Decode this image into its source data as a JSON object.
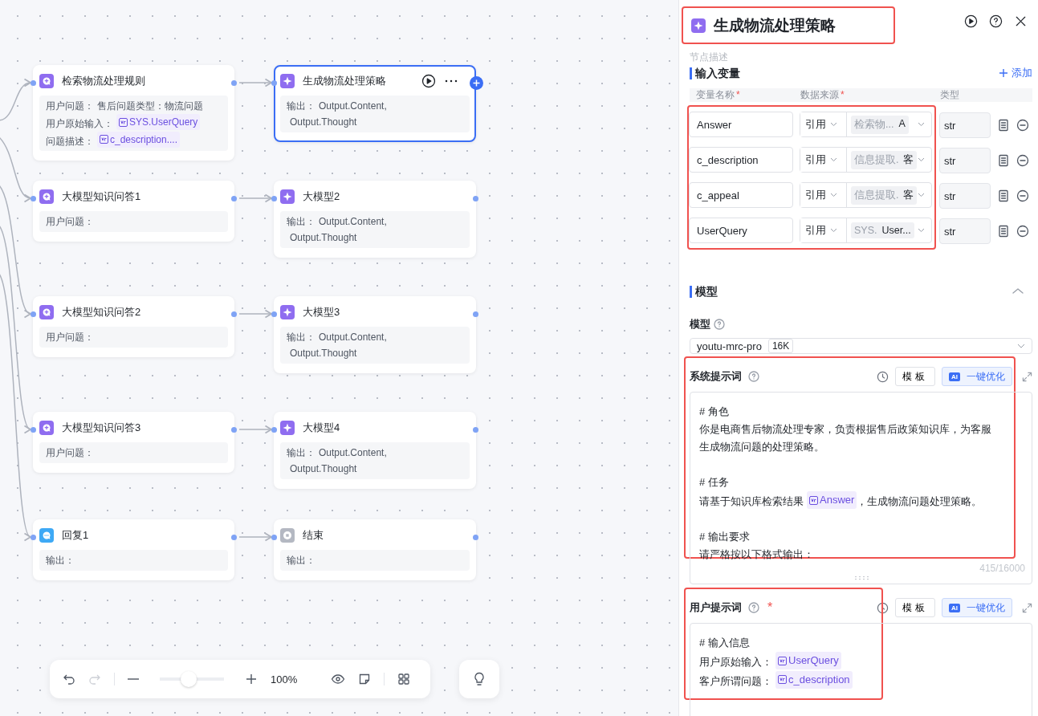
{
  "canvas": {
    "nodes": [
      {
        "kind": "knowledge",
        "title": "检索物流处理规则",
        "selected": false,
        "lines": [
          {
            "label": "用户问题：",
            "text": "售后问题类型：物流问题"
          },
          {
            "label": "用户原始输入：",
            "var": "SYS.UserQuery"
          },
          {
            "label": "问题描述：",
            "var": "c_description...."
          }
        ]
      },
      {
        "kind": "llm",
        "title": "生成物流处理策略",
        "selected": true,
        "lines": [
          {
            "label": "输出：",
            "text": "Output.Content,"
          },
          {
            "text": "Output.Thought"
          }
        ]
      },
      {
        "kind": "knowledge",
        "title": "大模型知识问答1",
        "selected": false,
        "lines": [
          {
            "label": "用户问题："
          }
        ]
      },
      {
        "kind": "llm",
        "title": "大模型2",
        "selected": false,
        "lines": [
          {
            "label": "输出：",
            "text": "Output.Content,"
          },
          {
            "text": "Output.Thought"
          }
        ]
      },
      {
        "kind": "knowledge",
        "title": "大模型知识问答2",
        "selected": false,
        "lines": [
          {
            "label": "用户问题："
          }
        ]
      },
      {
        "kind": "llm",
        "title": "大模型3",
        "selected": false,
        "lines": [
          {
            "label": "输出：",
            "text": "Output.Content,"
          },
          {
            "text": "Output.Thought"
          }
        ]
      },
      {
        "kind": "knowledge",
        "title": "大模型知识问答3",
        "selected": false,
        "lines": [
          {
            "label": "用户问题："
          }
        ]
      },
      {
        "kind": "llm",
        "title": "大模型4",
        "selected": false,
        "lines": [
          {
            "label": "输出：",
            "text": "Output.Content,"
          },
          {
            "text": "Output.Thought"
          }
        ]
      },
      {
        "kind": "reply",
        "title": "回复1",
        "selected": false,
        "lines": [
          {
            "label": "输出："
          }
        ]
      },
      {
        "kind": "end",
        "title": "结束",
        "selected": false,
        "lines": [
          {
            "label": "输出："
          }
        ]
      }
    ],
    "toolbar": {
      "zoom": "100%",
      "level": 0.45,
      "redo_disabled": true
    }
  },
  "panel": {
    "title": "生成物流处理策略",
    "description_placeholder": "节点描述",
    "inputs": {
      "title": "输入变量",
      "add": "添加",
      "columns": [
        {
          "label": "变量名称",
          "required_mark": "*"
        },
        {
          "label": "数据来源",
          "required_mark": "*"
        },
        {
          "label": "类型"
        }
      ],
      "rows": [
        {
          "name": "Answer",
          "mode": "引用",
          "source_node": "检索物...",
          "source_field": "A",
          "type": "str"
        },
        {
          "name": "c_description",
          "mode": "引用",
          "source_node": "信息提取.",
          "source_field": "客",
          "type": "str"
        },
        {
          "name": "c_appeal",
          "mode": "引用",
          "source_node": "信息提取.",
          "source_field": "客",
          "type": "str"
        },
        {
          "name": "UserQuery",
          "mode": "引用",
          "source_node": "SYS.",
          "source_field": "User...",
          "type": "str"
        }
      ]
    },
    "model_section": {
      "title": "模型",
      "expanded": true,
      "label": "模型",
      "model": "youtu-mrc-pro",
      "context": "16K"
    },
    "prompts": [
      {
        "label": "系统提示词",
        "template": "模板",
        "badge": "AI",
        "optimize": "一键优化",
        "counter": "415/16000",
        "lines": [
          {
            "kind": "gap"
          },
          {
            "kind": "text",
            "parts": [
              {
                "text": "# 角色"
              }
            ]
          },
          {
            "kind": "text",
            "parts": [
              {
                "text": "你是电商售后物流处理专家，负责根据售后政策知识库，为客服"
              }
            ]
          },
          {
            "kind": "text",
            "parts": [
              {
                "text": "生成物流问题的处理策略。"
              }
            ]
          },
          {
            "kind": "gap"
          },
          {
            "kind": "text",
            "parts": [
              {
                "text": "# 任务"
              }
            ]
          },
          {
            "kind": "text",
            "parts": [
              {
                "text": "请基于知识库检索结果"
              },
              {
                "var": "Answer"
              },
              {
                "text": "，生成物流问题处理策略。"
              }
            ]
          },
          {
            "kind": "gap"
          },
          {
            "kind": "text",
            "parts": [
              {
                "text": "# 输出要求"
              }
            ]
          },
          {
            "kind": "text",
            "parts": [
              {
                "text": "请严格按以下格式输出："
              }
            ]
          }
        ]
      },
      {
        "label": "用户提示词",
        "required_mark": "*",
        "template": "模板",
        "badge": "AI",
        "optimize": "一键优化",
        "lines": [
          {
            "kind": "gap"
          },
          {
            "kind": "text",
            "parts": [
              {
                "text": "# 输入信息"
              }
            ]
          },
          {
            "kind": "text",
            "parts": [
              {
                "text": "用户原始输入："
              },
              {
                "var": "UserQuery"
              }
            ]
          },
          {
            "kind": "text",
            "parts": [
              {
                "text": "客户所谓问题："
              },
              {
                "var": "c_description"
              }
            ]
          }
        ]
      }
    ]
  }
}
